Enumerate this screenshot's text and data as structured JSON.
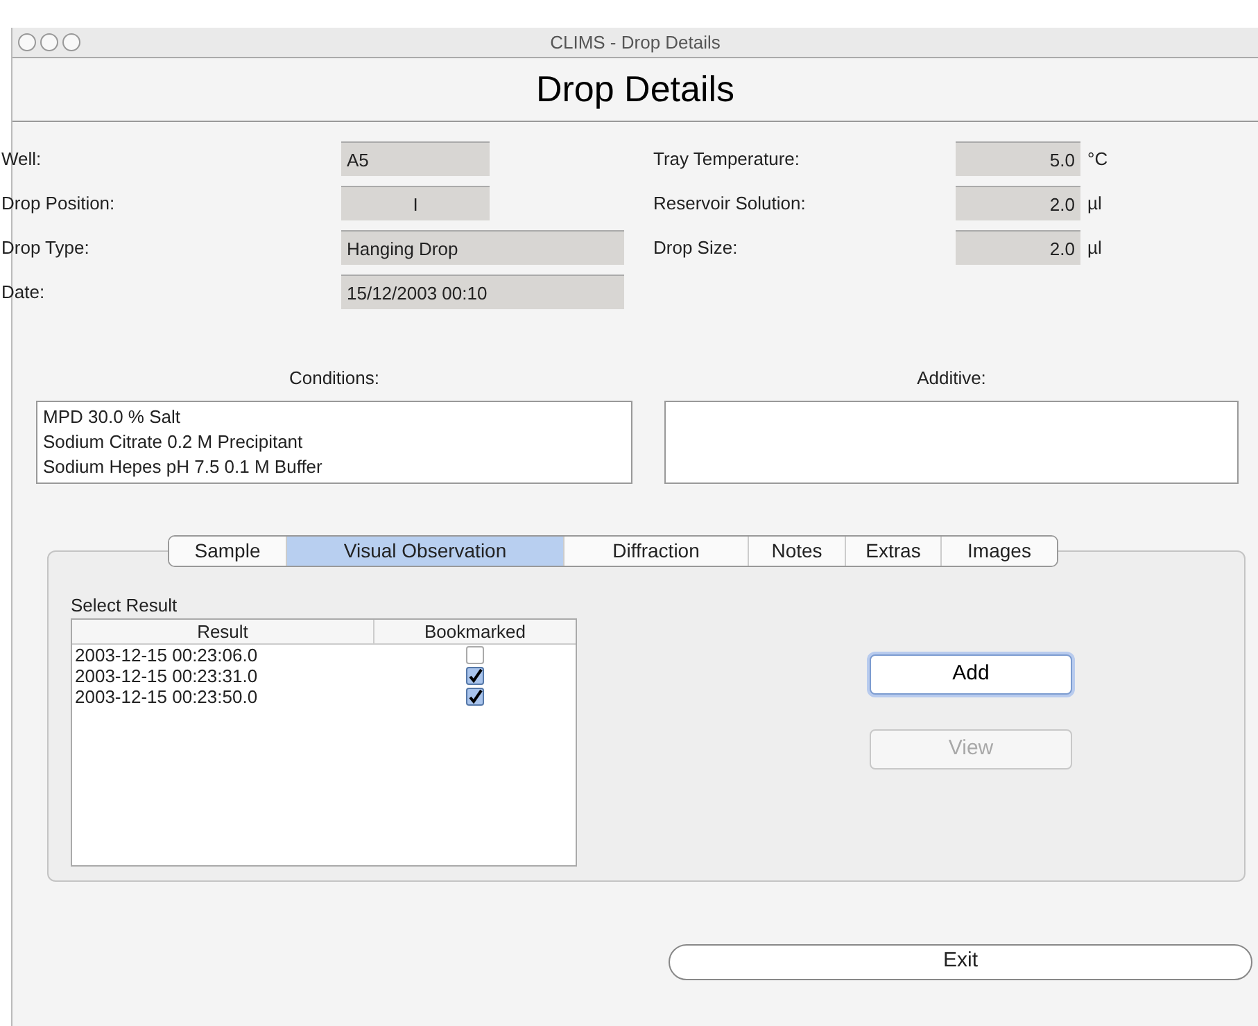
{
  "window": {
    "title": "CLIMS - Drop Details"
  },
  "heading": "Drop Details",
  "left_fields": [
    {
      "label": "Well:",
      "value": "A5",
      "kind": "short"
    },
    {
      "label": "Drop Position:",
      "value": "I",
      "kind": "centered"
    },
    {
      "label": "Drop Type:",
      "value": "Hanging Drop",
      "kind": "long"
    },
    {
      "label": "Date:",
      "value": "15/12/2003 00:10",
      "kind": "long"
    }
  ],
  "right_fields": [
    {
      "label": "Tray Temperature:",
      "value": "5.0",
      "unit": "°C"
    },
    {
      "label": "Reservoir Solution:",
      "value": "2.0",
      "unit": "µl"
    },
    {
      "label": "Drop Size:",
      "value": "2.0",
      "unit": "µl"
    }
  ],
  "conditions": {
    "label": "Conditions:",
    "lines": [
      "MPD 30.0 % Salt",
      "Sodium Citrate 0.2 M Precipitant",
      "Sodium Hepes pH 7.5 0.1 M Buffer"
    ]
  },
  "additive": {
    "label": "Additive:"
  },
  "tabs": [
    {
      "label": "Sample",
      "selected": false
    },
    {
      "label": "Visual Observation",
      "selected": true
    },
    {
      "label": "Diffraction",
      "selected": false
    },
    {
      "label": "Notes",
      "selected": false
    },
    {
      "label": "Extras",
      "selected": false
    },
    {
      "label": "Images",
      "selected": false
    }
  ],
  "results": {
    "label": "Select Result",
    "columns": [
      "Result",
      "Bookmarked"
    ],
    "rows": [
      {
        "result": "2003-12-15 00:23:06.0",
        "bookmarked": false
      },
      {
        "result": "2003-12-15 00:23:31.0",
        "bookmarked": true
      },
      {
        "result": "2003-12-15 00:23:50.0",
        "bookmarked": true
      }
    ]
  },
  "buttons": [
    {
      "label": "Add",
      "default": true,
      "disabled": false
    },
    {
      "label": "View",
      "default": false,
      "disabled": true
    }
  ],
  "exit_button": {
    "label": "Exit"
  }
}
